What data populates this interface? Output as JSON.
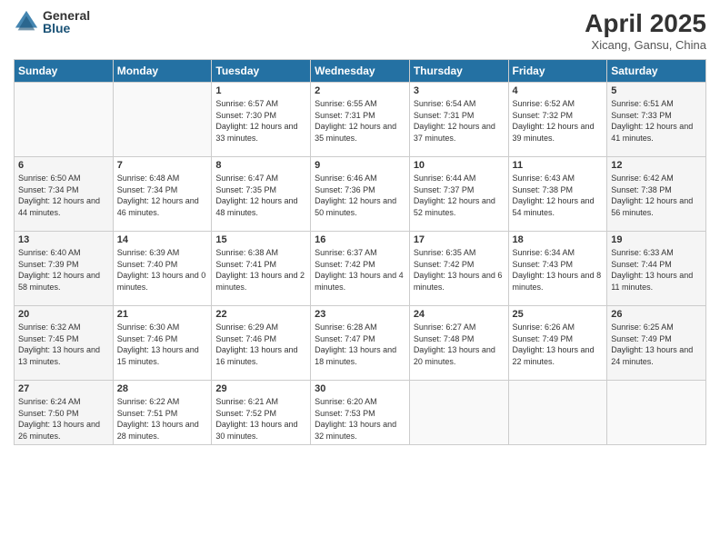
{
  "logo": {
    "general": "General",
    "blue": "Blue"
  },
  "header": {
    "title": "April 2025",
    "subtitle": "Xicang, Gansu, China"
  },
  "days_of_week": [
    "Sunday",
    "Monday",
    "Tuesday",
    "Wednesday",
    "Thursday",
    "Friday",
    "Saturday"
  ],
  "weeks": [
    [
      {
        "day": "",
        "info": ""
      },
      {
        "day": "",
        "info": ""
      },
      {
        "day": "1",
        "info": "Sunrise: 6:57 AM\nSunset: 7:30 PM\nDaylight: 12 hours and 33 minutes."
      },
      {
        "day": "2",
        "info": "Sunrise: 6:55 AM\nSunset: 7:31 PM\nDaylight: 12 hours and 35 minutes."
      },
      {
        "day": "3",
        "info": "Sunrise: 6:54 AM\nSunset: 7:31 PM\nDaylight: 12 hours and 37 minutes."
      },
      {
        "day": "4",
        "info": "Sunrise: 6:52 AM\nSunset: 7:32 PM\nDaylight: 12 hours and 39 minutes."
      },
      {
        "day": "5",
        "info": "Sunrise: 6:51 AM\nSunset: 7:33 PM\nDaylight: 12 hours and 41 minutes."
      }
    ],
    [
      {
        "day": "6",
        "info": "Sunrise: 6:50 AM\nSunset: 7:34 PM\nDaylight: 12 hours and 44 minutes."
      },
      {
        "day": "7",
        "info": "Sunrise: 6:48 AM\nSunset: 7:34 PM\nDaylight: 12 hours and 46 minutes."
      },
      {
        "day": "8",
        "info": "Sunrise: 6:47 AM\nSunset: 7:35 PM\nDaylight: 12 hours and 48 minutes."
      },
      {
        "day": "9",
        "info": "Sunrise: 6:46 AM\nSunset: 7:36 PM\nDaylight: 12 hours and 50 minutes."
      },
      {
        "day": "10",
        "info": "Sunrise: 6:44 AM\nSunset: 7:37 PM\nDaylight: 12 hours and 52 minutes."
      },
      {
        "day": "11",
        "info": "Sunrise: 6:43 AM\nSunset: 7:38 PM\nDaylight: 12 hours and 54 minutes."
      },
      {
        "day": "12",
        "info": "Sunrise: 6:42 AM\nSunset: 7:38 PM\nDaylight: 12 hours and 56 minutes."
      }
    ],
    [
      {
        "day": "13",
        "info": "Sunrise: 6:40 AM\nSunset: 7:39 PM\nDaylight: 12 hours and 58 minutes."
      },
      {
        "day": "14",
        "info": "Sunrise: 6:39 AM\nSunset: 7:40 PM\nDaylight: 13 hours and 0 minutes."
      },
      {
        "day": "15",
        "info": "Sunrise: 6:38 AM\nSunset: 7:41 PM\nDaylight: 13 hours and 2 minutes."
      },
      {
        "day": "16",
        "info": "Sunrise: 6:37 AM\nSunset: 7:42 PM\nDaylight: 13 hours and 4 minutes."
      },
      {
        "day": "17",
        "info": "Sunrise: 6:35 AM\nSunset: 7:42 PM\nDaylight: 13 hours and 6 minutes."
      },
      {
        "day": "18",
        "info": "Sunrise: 6:34 AM\nSunset: 7:43 PM\nDaylight: 13 hours and 8 minutes."
      },
      {
        "day": "19",
        "info": "Sunrise: 6:33 AM\nSunset: 7:44 PM\nDaylight: 13 hours and 11 minutes."
      }
    ],
    [
      {
        "day": "20",
        "info": "Sunrise: 6:32 AM\nSunset: 7:45 PM\nDaylight: 13 hours and 13 minutes."
      },
      {
        "day": "21",
        "info": "Sunrise: 6:30 AM\nSunset: 7:46 PM\nDaylight: 13 hours and 15 minutes."
      },
      {
        "day": "22",
        "info": "Sunrise: 6:29 AM\nSunset: 7:46 PM\nDaylight: 13 hours and 16 minutes."
      },
      {
        "day": "23",
        "info": "Sunrise: 6:28 AM\nSunset: 7:47 PM\nDaylight: 13 hours and 18 minutes."
      },
      {
        "day": "24",
        "info": "Sunrise: 6:27 AM\nSunset: 7:48 PM\nDaylight: 13 hours and 20 minutes."
      },
      {
        "day": "25",
        "info": "Sunrise: 6:26 AM\nSunset: 7:49 PM\nDaylight: 13 hours and 22 minutes."
      },
      {
        "day": "26",
        "info": "Sunrise: 6:25 AM\nSunset: 7:49 PM\nDaylight: 13 hours and 24 minutes."
      }
    ],
    [
      {
        "day": "27",
        "info": "Sunrise: 6:24 AM\nSunset: 7:50 PM\nDaylight: 13 hours and 26 minutes."
      },
      {
        "day": "28",
        "info": "Sunrise: 6:22 AM\nSunset: 7:51 PM\nDaylight: 13 hours and 28 minutes."
      },
      {
        "day": "29",
        "info": "Sunrise: 6:21 AM\nSunset: 7:52 PM\nDaylight: 13 hours and 30 minutes."
      },
      {
        "day": "30",
        "info": "Sunrise: 6:20 AM\nSunset: 7:53 PM\nDaylight: 13 hours and 32 minutes."
      },
      {
        "day": "",
        "info": ""
      },
      {
        "day": "",
        "info": ""
      },
      {
        "day": "",
        "info": ""
      }
    ]
  ]
}
